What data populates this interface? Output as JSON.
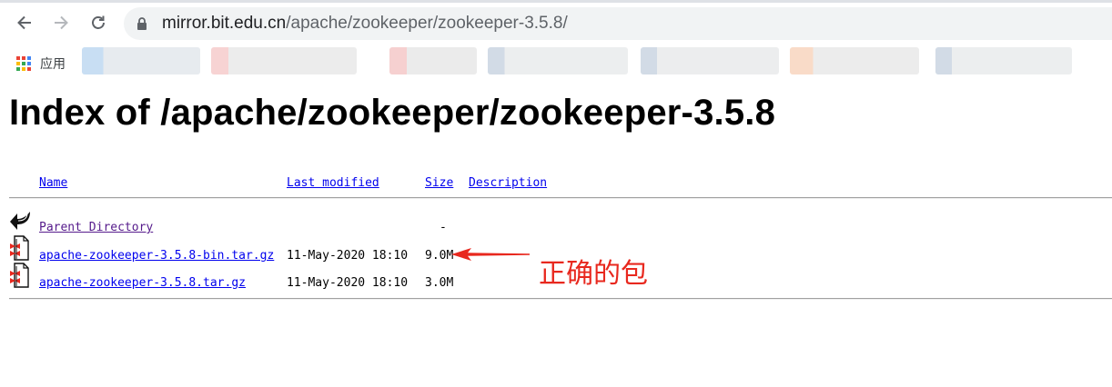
{
  "browser": {
    "url_host": "mirror.bit.edu.cn",
    "url_path": "/apache/zookeeper/zookeeper-3.5.8/",
    "apps_label": "应用"
  },
  "page": {
    "title": "Index of /apache/zookeeper/zookeeper-3.5.8",
    "columns": {
      "name": "Name",
      "last_modified": "Last modified",
      "size": "Size",
      "description": "Description"
    },
    "parent": {
      "name": "Parent Directory",
      "size": "-"
    },
    "rows": [
      {
        "name": "apache-zookeeper-3.5.8-bin.tar.gz",
        "modified": "11-May-2020 18:10",
        "size": "9.0M"
      },
      {
        "name": "apache-zookeeper-3.5.8.tar.gz",
        "modified": "11-May-2020 18:10",
        "size": "3.0M"
      }
    ]
  },
  "annotation": {
    "text": "正确的包",
    "color": "#e8281e"
  },
  "icons": [
    "back-arrow-icon",
    "forward-arrow-icon",
    "reload-icon",
    "lock-icon",
    "apps-grid-icon",
    "parent-directory-icon",
    "compressed-file-icon"
  ]
}
